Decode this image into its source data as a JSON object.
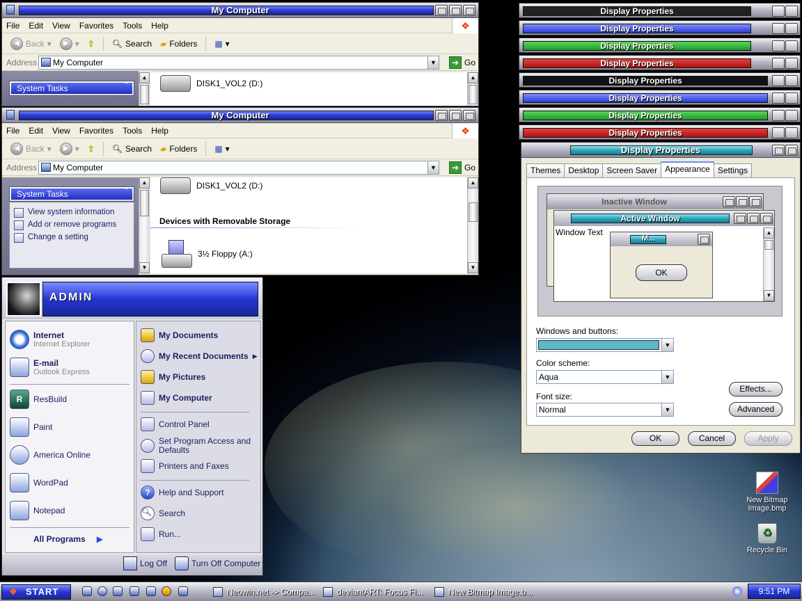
{
  "explorer": {
    "title": "My Computer",
    "menu": [
      "File",
      "Edit",
      "View",
      "Favorites",
      "Tools",
      "Help"
    ],
    "toolbar": {
      "back": "Back",
      "search": "Search",
      "folders": "Folders"
    },
    "address_label": "Address",
    "address_value": "My Computer",
    "go": "Go",
    "system_tasks": "System Tasks",
    "tasks": [
      "View system information",
      "Add or remove programs",
      "Change a setting"
    ],
    "drive_d": "DISK1_VOL2 (D:)",
    "section_removable": "Devices with Removable Storage",
    "floppy": "3½ Floppy (A:)"
  },
  "display_properties": {
    "title": "Display Properties",
    "bar_colors": [
      "#222222",
      "#2b3ad0",
      "#1f9a2a",
      "#b01010",
      "#222222",
      "#2b3ad0",
      "#1f9a2a",
      "#b01010",
      "#2aa6b8"
    ],
    "tabs": [
      "Themes",
      "Desktop",
      "Screen Saver",
      "Appearance",
      "Settings"
    ],
    "active_tab": "Appearance",
    "preview": {
      "inactive": "Inactive Window",
      "active": "Active Window",
      "window_text": "Window Text",
      "msgbox": "M...",
      "ok": "OK"
    },
    "windows_buttons_label": "Windows and buttons:",
    "color_scheme_label": "Color scheme:",
    "color_scheme_value": "Aqua",
    "font_size_label": "Font size:",
    "font_size_value": "Normal",
    "effects": "Effects...",
    "advanced": "Advanced",
    "ok": "OK",
    "cancel": "Cancel",
    "apply": "Apply"
  },
  "start_menu": {
    "user": "ADMIN",
    "pinned": [
      {
        "title": "Internet",
        "sub": "Internet Explorer"
      },
      {
        "title": "E-mail",
        "sub": "Outlook Express"
      }
    ],
    "recent": [
      "ResBuild",
      "Paint",
      "America Online",
      "WordPad",
      "Notepad"
    ],
    "all_programs": "All Programs",
    "right": [
      "My Documents",
      "My Recent Documents",
      "My Pictures",
      "My Computer"
    ],
    "right2": [
      "Control Panel",
      "Set Program Access and Defaults",
      "Printers and Faxes"
    ],
    "right3": [
      "Help and Support",
      "Search",
      "Run..."
    ],
    "log_off": "Log Off",
    "turn_off": "Turn Off Computer"
  },
  "taskbar": {
    "start": "START",
    "items": [
      "Neowin.net -> Compa...",
      "deviantART: Focus Fi...",
      "New Bitmap Image.b..."
    ],
    "clock": "9:51 PM"
  },
  "desktop": {
    "icons": [
      "New Bitmap Image.bmp",
      "Recycle Bin"
    ]
  }
}
